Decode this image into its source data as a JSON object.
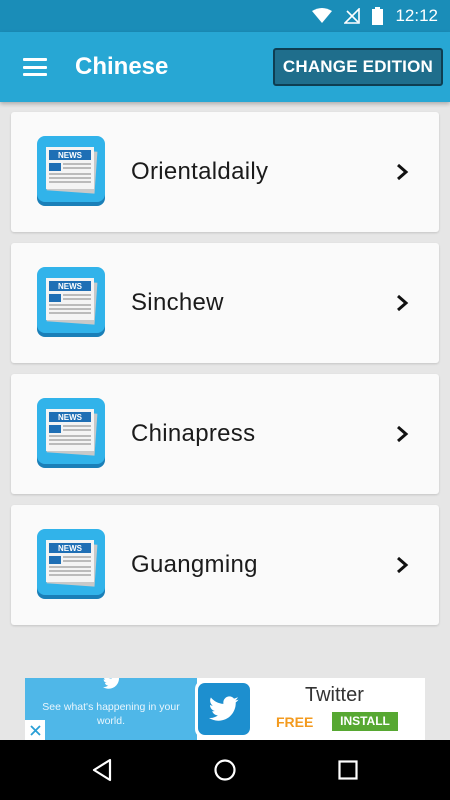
{
  "status_bar": {
    "time": "12:12",
    "icons": [
      "wifi-icon",
      "no-signal-icon",
      "battery-icon"
    ]
  },
  "app_bar": {
    "title": "Chinese",
    "change_edition_label": "CHANGE EDITION",
    "menu_icon": "hamburger-menu-icon"
  },
  "list": {
    "items": [
      {
        "label": "Orientaldaily",
        "icon": "news-icon",
        "icon_text": "NEWS"
      },
      {
        "label": "Sinchew",
        "icon": "news-icon",
        "icon_text": "NEWS"
      },
      {
        "label": "Chinapress",
        "icon": "news-icon",
        "icon_text": "NEWS"
      },
      {
        "label": "Guangming",
        "icon": "news-icon",
        "icon_text": "NEWS"
      }
    ]
  },
  "ad": {
    "tagline": "See what's happening in your world.",
    "app_name": "Twitter",
    "free_label": "FREE",
    "install_label": "INSTALL"
  },
  "nav_bar": {
    "icons": [
      "back-icon",
      "home-icon",
      "recents-icon"
    ]
  },
  "colors": {
    "status_bar": "#1a8db8",
    "app_bar": "#27a7d4",
    "button": "#1f6e8c",
    "background": "#e6e6e6",
    "card": "#fafafa"
  }
}
